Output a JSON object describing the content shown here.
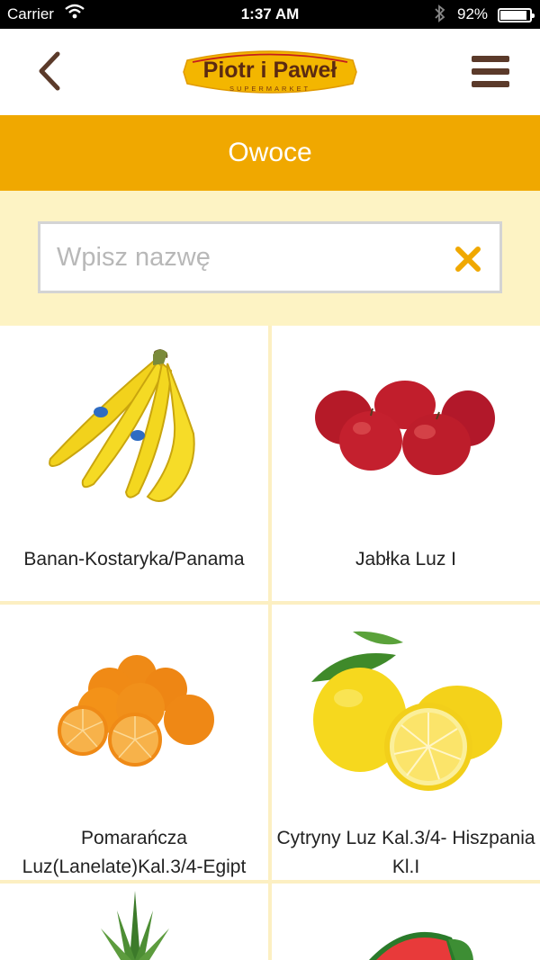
{
  "status_bar": {
    "carrier": "Carrier",
    "time": "1:37 AM",
    "battery_text": "92%",
    "battery_level": 0.92
  },
  "nav": {
    "logo_text": "Piotr i Paweł",
    "logo_subtext": "SUPERMARKET",
    "back_icon": "chevron-left-icon",
    "menu_icon": "hamburger-menu-icon"
  },
  "page": {
    "title": "Owoce"
  },
  "search": {
    "placeholder": "Wpisz nazwę",
    "value": "",
    "clear_icon": "close-icon"
  },
  "colors": {
    "accent": "#f0a800",
    "panel": "#fdf3c4",
    "brand_brown": "#5b3a2a"
  },
  "products": [
    {
      "name": "Banan-Kostaryka/Panama",
      "image": "bananas"
    },
    {
      "name": "Jabłka Luz I",
      "image": "red-apples"
    },
    {
      "name": "Pomarańcza Luz(Lanelate)Kal.3/4-Egipt",
      "image": "oranges"
    },
    {
      "name": "Cytryny Luz Kal.3/4- Hiszpania Kl.I",
      "image": "lemons"
    },
    {
      "name": "",
      "image": "pineapple"
    },
    {
      "name": "",
      "image": "watermelon"
    }
  ]
}
